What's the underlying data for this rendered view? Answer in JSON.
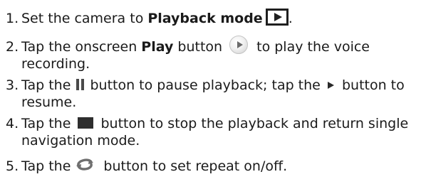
{
  "steps": [
    {
      "number": "1.",
      "pre": "Set the camera to ",
      "bold": "Playback mode",
      "post": ".",
      "icon": "playback-mode-icon"
    },
    {
      "number": "2.",
      "pre": "Tap the onscreen ",
      "bold": "Play",
      "mid": " button",
      "post": " to play the voice recording.",
      "icon": "play-circle-icon"
    },
    {
      "number": "3.",
      "pre": "Tap the",
      "mid": " button to pause playback; tap the",
      "post": " button to resume.",
      "icons": [
        "pause-icon",
        "play-triangle-icon"
      ]
    },
    {
      "number": "4.",
      "pre": "Tap the",
      "post": " button to stop the playback and return single navigation mode.",
      "icon": "stop-icon"
    },
    {
      "number": "5.",
      "pre": "Tap the",
      "post": " button to set repeat on/off.",
      "icon": "repeat-icon"
    }
  ],
  "colors": {
    "text": "#1a1a1a",
    "icon_dark": "#1f1f1f",
    "icon_repeat": "#6f6f6f"
  }
}
